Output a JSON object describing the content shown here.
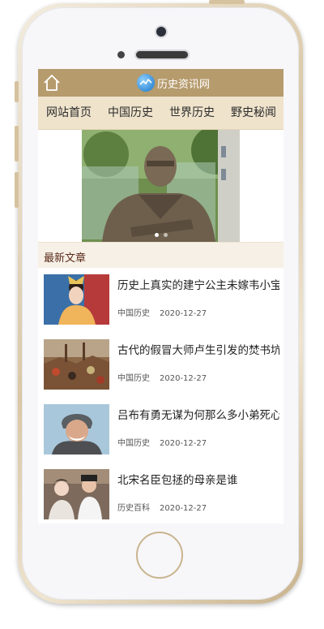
{
  "header": {
    "site_name": "历史资讯网"
  },
  "nav": {
    "items": [
      {
        "label": "网站首页"
      },
      {
        "label": "中国历史"
      },
      {
        "label": "世界历史"
      },
      {
        "label": "野史秘闻"
      }
    ]
  },
  "section": {
    "title": "最新文章"
  },
  "articles": [
    {
      "title": "历史上真实的建宁公主未嫁韦小宝",
      "category": "中国历史",
      "date": "2020-12-27"
    },
    {
      "title": "古代的假冒大师卢生引发的焚书坑",
      "category": "中国历史",
      "date": "2020-12-27"
    },
    {
      "title": "吕布有勇无谋为何那么多小弟死心",
      "category": "中国历史",
      "date": "2020-12-27"
    },
    {
      "title": "北宋名臣包拯的母亲是谁",
      "category": "历史百科",
      "date": "2020-12-27"
    }
  ],
  "colors": {
    "header_bg": "#b69b6d",
    "nav_bg": "#efe3cc",
    "section_title": "#5b2a1a",
    "frame_gold": "#d9c7a6"
  },
  "icons": {
    "home": "home-icon",
    "logo": "logo-icon"
  }
}
